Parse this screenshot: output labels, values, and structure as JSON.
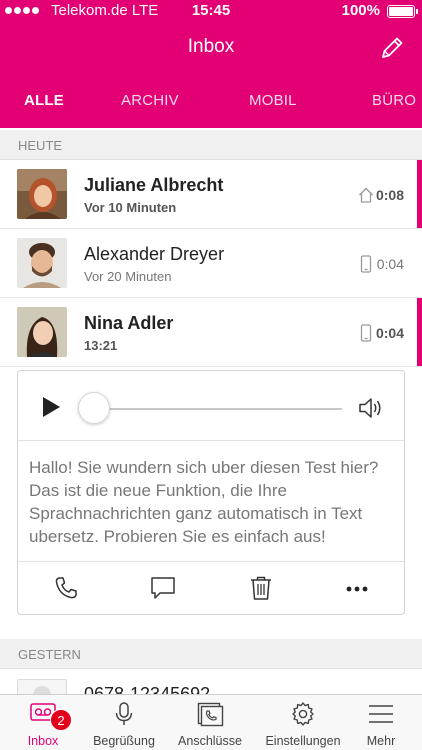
{
  "status_bar": {
    "carrier": "Telekom.de  LTE",
    "time": "15:45",
    "battery": "100%"
  },
  "header": {
    "title": "Inbox"
  },
  "tabs": [
    {
      "label": "ALLE",
      "active": true
    },
    {
      "label": "ARCHIV",
      "active": false
    },
    {
      "label": "MOBIL",
      "active": false
    },
    {
      "label": "BÜRO",
      "active": false
    }
  ],
  "sections": {
    "today": "HEUTE",
    "yesterday": "GESTERN"
  },
  "messages": [
    {
      "name": "Juliane Albrecht",
      "time": "Vor 10 Minuten",
      "duration": "0:08",
      "line": "home-icon",
      "unread": true
    },
    {
      "name": "Alexander Dreyer",
      "time": "Vor 20 Minuten",
      "duration": "0:04",
      "line": "mobile-icon",
      "unread": false
    },
    {
      "name": "Nina Adler",
      "time": "13:21",
      "duration": "0:04",
      "line": "mobile-icon",
      "unread": true
    }
  ],
  "player": {
    "transcript": "Hallo! Sie wundern sich uber diesen Test hier? Das ist die neue Funktion, die Ihre Sprachnachrichten ganz automatisch in Text ubersetz. Probieren Sie es einfach aus!",
    "progress": 0
  },
  "actions": [
    "phone-icon",
    "message-icon",
    "trash-icon",
    "more-icon"
  ],
  "peek": {
    "number": "0678-12345692"
  },
  "tabbar": {
    "items": [
      {
        "label": "Inbox",
        "icon": "voicemail-icon",
        "active": true,
        "badge": "2"
      },
      {
        "label": "Begrüßung",
        "icon": "microphone-icon",
        "active": false
      },
      {
        "label": "Anschlüsse",
        "icon": "phone-icon",
        "active": false
      },
      {
        "label": "Einstellungen",
        "icon": "gear-icon",
        "active": false
      },
      {
        "label": "Mehr",
        "icon": "menu-icon",
        "active": false
      }
    ]
  },
  "colors": {
    "brand": "#e20074",
    "badge": "#e2001a"
  }
}
